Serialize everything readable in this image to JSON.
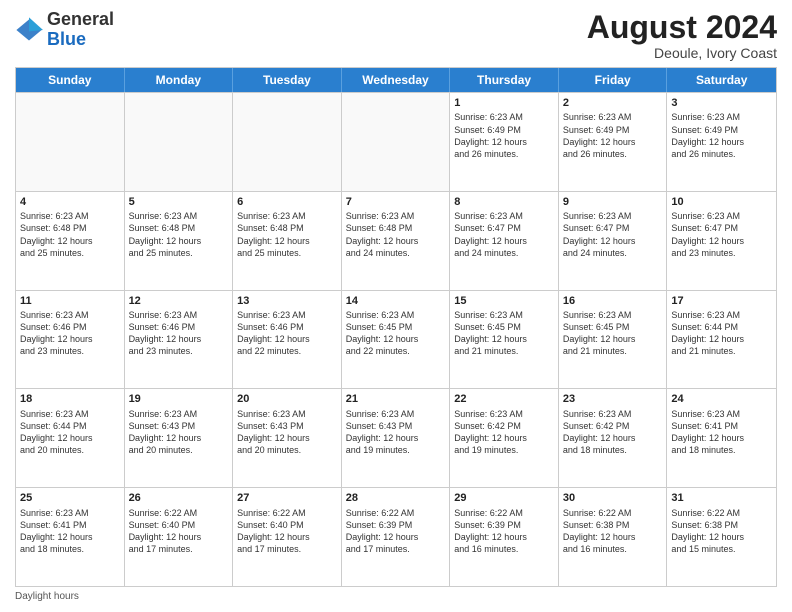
{
  "header": {
    "logo_general": "General",
    "logo_blue": "Blue",
    "month_year": "August 2024",
    "location": "Deoule, Ivory Coast"
  },
  "days_of_week": [
    "Sunday",
    "Monday",
    "Tuesday",
    "Wednesday",
    "Thursday",
    "Friday",
    "Saturday"
  ],
  "weeks": [
    [
      {
        "day": "",
        "info": ""
      },
      {
        "day": "",
        "info": ""
      },
      {
        "day": "",
        "info": ""
      },
      {
        "day": "",
        "info": ""
      },
      {
        "day": "1",
        "info": "Sunrise: 6:23 AM\nSunset: 6:49 PM\nDaylight: 12 hours\nand 26 minutes."
      },
      {
        "day": "2",
        "info": "Sunrise: 6:23 AM\nSunset: 6:49 PM\nDaylight: 12 hours\nand 26 minutes."
      },
      {
        "day": "3",
        "info": "Sunrise: 6:23 AM\nSunset: 6:49 PM\nDaylight: 12 hours\nand 26 minutes."
      }
    ],
    [
      {
        "day": "4",
        "info": "Sunrise: 6:23 AM\nSunset: 6:48 PM\nDaylight: 12 hours\nand 25 minutes."
      },
      {
        "day": "5",
        "info": "Sunrise: 6:23 AM\nSunset: 6:48 PM\nDaylight: 12 hours\nand 25 minutes."
      },
      {
        "day": "6",
        "info": "Sunrise: 6:23 AM\nSunset: 6:48 PM\nDaylight: 12 hours\nand 25 minutes."
      },
      {
        "day": "7",
        "info": "Sunrise: 6:23 AM\nSunset: 6:48 PM\nDaylight: 12 hours\nand 24 minutes."
      },
      {
        "day": "8",
        "info": "Sunrise: 6:23 AM\nSunset: 6:47 PM\nDaylight: 12 hours\nand 24 minutes."
      },
      {
        "day": "9",
        "info": "Sunrise: 6:23 AM\nSunset: 6:47 PM\nDaylight: 12 hours\nand 24 minutes."
      },
      {
        "day": "10",
        "info": "Sunrise: 6:23 AM\nSunset: 6:47 PM\nDaylight: 12 hours\nand 23 minutes."
      }
    ],
    [
      {
        "day": "11",
        "info": "Sunrise: 6:23 AM\nSunset: 6:46 PM\nDaylight: 12 hours\nand 23 minutes."
      },
      {
        "day": "12",
        "info": "Sunrise: 6:23 AM\nSunset: 6:46 PM\nDaylight: 12 hours\nand 23 minutes."
      },
      {
        "day": "13",
        "info": "Sunrise: 6:23 AM\nSunset: 6:46 PM\nDaylight: 12 hours\nand 22 minutes."
      },
      {
        "day": "14",
        "info": "Sunrise: 6:23 AM\nSunset: 6:45 PM\nDaylight: 12 hours\nand 22 minutes."
      },
      {
        "day": "15",
        "info": "Sunrise: 6:23 AM\nSunset: 6:45 PM\nDaylight: 12 hours\nand 21 minutes."
      },
      {
        "day": "16",
        "info": "Sunrise: 6:23 AM\nSunset: 6:45 PM\nDaylight: 12 hours\nand 21 minutes."
      },
      {
        "day": "17",
        "info": "Sunrise: 6:23 AM\nSunset: 6:44 PM\nDaylight: 12 hours\nand 21 minutes."
      }
    ],
    [
      {
        "day": "18",
        "info": "Sunrise: 6:23 AM\nSunset: 6:44 PM\nDaylight: 12 hours\nand 20 minutes."
      },
      {
        "day": "19",
        "info": "Sunrise: 6:23 AM\nSunset: 6:43 PM\nDaylight: 12 hours\nand 20 minutes."
      },
      {
        "day": "20",
        "info": "Sunrise: 6:23 AM\nSunset: 6:43 PM\nDaylight: 12 hours\nand 20 minutes."
      },
      {
        "day": "21",
        "info": "Sunrise: 6:23 AM\nSunset: 6:43 PM\nDaylight: 12 hours\nand 19 minutes."
      },
      {
        "day": "22",
        "info": "Sunrise: 6:23 AM\nSunset: 6:42 PM\nDaylight: 12 hours\nand 19 minutes."
      },
      {
        "day": "23",
        "info": "Sunrise: 6:23 AM\nSunset: 6:42 PM\nDaylight: 12 hours\nand 18 minutes."
      },
      {
        "day": "24",
        "info": "Sunrise: 6:23 AM\nSunset: 6:41 PM\nDaylight: 12 hours\nand 18 minutes."
      }
    ],
    [
      {
        "day": "25",
        "info": "Sunrise: 6:23 AM\nSunset: 6:41 PM\nDaylight: 12 hours\nand 18 minutes."
      },
      {
        "day": "26",
        "info": "Sunrise: 6:22 AM\nSunset: 6:40 PM\nDaylight: 12 hours\nand 17 minutes."
      },
      {
        "day": "27",
        "info": "Sunrise: 6:22 AM\nSunset: 6:40 PM\nDaylight: 12 hours\nand 17 minutes."
      },
      {
        "day": "28",
        "info": "Sunrise: 6:22 AM\nSunset: 6:39 PM\nDaylight: 12 hours\nand 17 minutes."
      },
      {
        "day": "29",
        "info": "Sunrise: 6:22 AM\nSunset: 6:39 PM\nDaylight: 12 hours\nand 16 minutes."
      },
      {
        "day": "30",
        "info": "Sunrise: 6:22 AM\nSunset: 6:38 PM\nDaylight: 12 hours\nand 16 minutes."
      },
      {
        "day": "31",
        "info": "Sunrise: 6:22 AM\nSunset: 6:38 PM\nDaylight: 12 hours\nand 15 minutes."
      }
    ]
  ],
  "footer": "Daylight hours"
}
